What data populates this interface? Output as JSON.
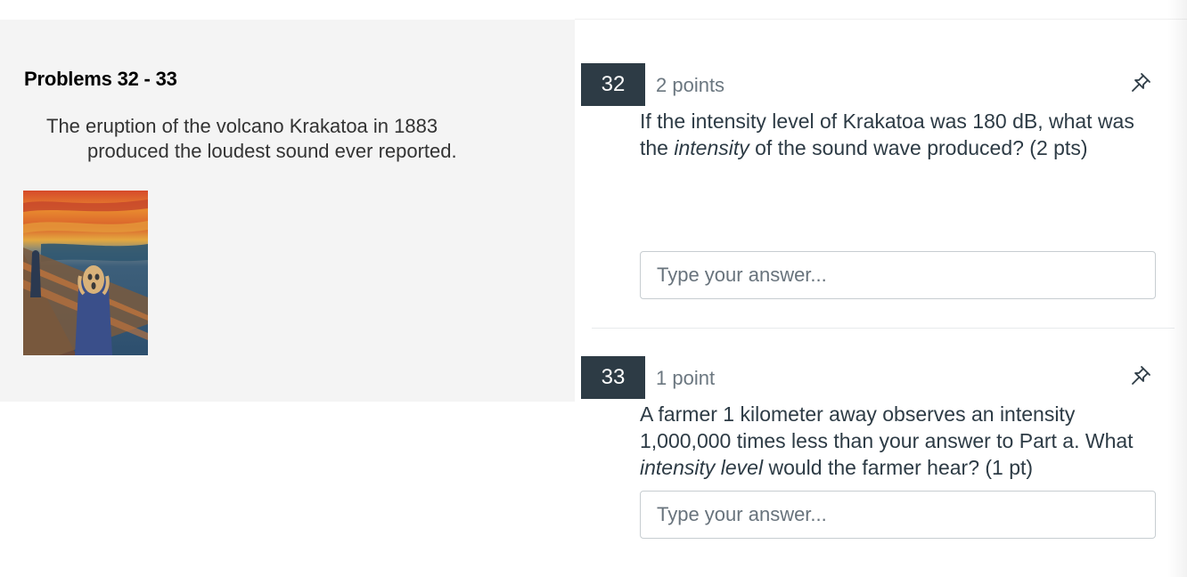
{
  "stimulus": {
    "title": "Problems 32 - 33",
    "passage_line1": "The eruption of the volcano Krakatoa in 1883",
    "passage_line2": "produced the loudest sound ever reported."
  },
  "questions": [
    {
      "number": "32",
      "points": "2 points",
      "text_before": "If the intensity level of Krakatoa was 180 dB, what was the ",
      "text_italic": "intensity",
      "text_after": " of the sound wave produced? (2 pts)",
      "answer_value": "",
      "answer_placeholder": "Type your answer..."
    },
    {
      "number": "33",
      "points": "1 point",
      "text_before": "A farmer 1 kilometer away observes an intensity 1,000,000 times less than your answer to Part a.  What ",
      "text_italic": "intensity level",
      "text_after": " would the farmer hear? (1 pt)",
      "answer_value": "",
      "answer_placeholder": "Type your answer..."
    }
  ],
  "icons": {
    "flag": "pin-icon"
  },
  "colors": {
    "number_badge": "#2d3b45",
    "points_text": "#6b7780",
    "stimulus_bg": "#f4f4f4"
  }
}
